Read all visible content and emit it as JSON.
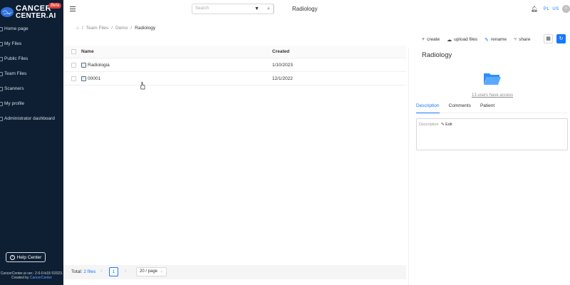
{
  "brand": {
    "line1": "CANCER",
    "line2": "CENTER.AI",
    "badge": "Beta"
  },
  "sidebar": {
    "items": [
      {
        "label": "Home page"
      },
      {
        "label": "My Files"
      },
      {
        "label": "Public Files"
      },
      {
        "label": "Team Files"
      },
      {
        "label": "Scanners"
      },
      {
        "label": "My profile"
      },
      {
        "label": "Administrator dashboard"
      }
    ],
    "help_label": "Help Center",
    "version_text": "CancerCenter.ai ver.: 2-0-0-b18 ©2023.",
    "created_by_prefix": "Created by",
    "created_by_link": "CancerCenter"
  },
  "header": {
    "search_placeholder": "Search",
    "title": "Radiology",
    "lang_pl": "PL",
    "lang_us": "US"
  },
  "breadcrumb": {
    "items": [
      "Team Files",
      "Demo",
      "Radiology"
    ]
  },
  "toolbar": {
    "create": "create",
    "upload": "upload files",
    "rename": "rename",
    "share": "share"
  },
  "table": {
    "headers": {
      "name": "Name",
      "created": "Created"
    },
    "rows": [
      {
        "name": "Radiologia",
        "created": "1/10/2023"
      },
      {
        "name": "00001",
        "created": "12/1/2022"
      }
    ]
  },
  "panel": {
    "title": "Radiology",
    "access_text": "13 users have access",
    "tabs": [
      "Description",
      "Comments",
      "Patient"
    ],
    "active_tab": 0,
    "description_label": "Description",
    "edit_label": "Edit"
  },
  "footer": {
    "total_prefix": "Total:",
    "total_count": "2 files",
    "current_page": "1",
    "page_size": "20 / page"
  },
  "colors": {
    "sidebar_bg": "#0e1f33",
    "accent": "#1677ff",
    "badge": "#e53935"
  }
}
